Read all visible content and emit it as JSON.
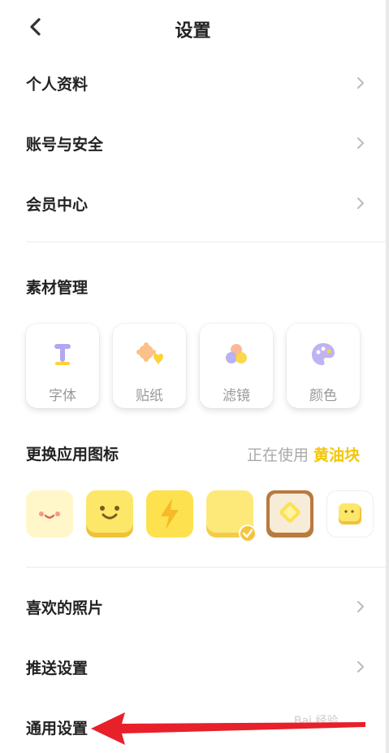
{
  "header": {
    "title": "设置",
    "back_icon": "chevron-left-icon"
  },
  "menu_top": [
    {
      "label": "个人资料"
    },
    {
      "label": "账号与安全"
    },
    {
      "label": "会员中心"
    }
  ],
  "materials": {
    "title": "素材管理",
    "items": [
      {
        "label": "字体",
        "icon": "font-icon"
      },
      {
        "label": "贴纸",
        "icon": "sticker-icon"
      },
      {
        "label": "滤镜",
        "icon": "filter-icon"
      },
      {
        "label": "颜色",
        "icon": "palette-icon"
      }
    ]
  },
  "app_icons": {
    "title": "更换应用图标",
    "using_label": "正在使用",
    "current": "黄油块",
    "colors": {
      "accent": "#f5c500",
      "butter": "#fde768"
    }
  },
  "menu_bottom": [
    {
      "label": "喜欢的照片"
    },
    {
      "label": "推送设置"
    },
    {
      "label": "通用设置"
    }
  ],
  "watermark": "Bai 经验"
}
